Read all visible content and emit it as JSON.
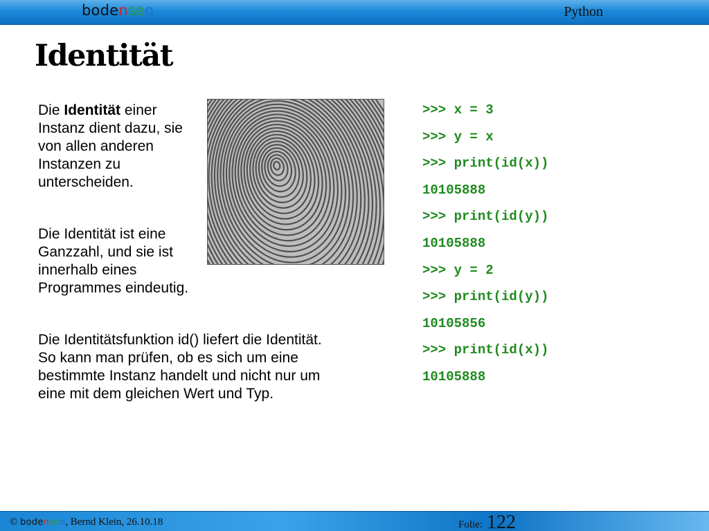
{
  "header": {
    "logo": {
      "part1": "bode",
      "part2": "n",
      "part3": "se",
      "part4": "o"
    },
    "title": "Python"
  },
  "slide": {
    "title": "Identität",
    "paragraph1": {
      "before": "Die ",
      "bold": "Identität",
      "after": " einer Instanz dient dazu, sie von allen anderen Instanzen zu unterscheiden."
    },
    "paragraph2": "Die Identität ist eine Ganzzahl, und sie ist innerhalb eines Programmes eindeutig.",
    "paragraph3": "Die Identitätsfunktion id() liefert die Identität. So kann man prüfen, ob es sich um eine bestimmte Instanz handelt und nicht nur um eine mit dem gleichen Wert und Typ.",
    "image": {
      "icon": "fingerprint-image"
    },
    "code_color": "#1e8a1e",
    "code_lines": [
      ">>> x = 3",
      ">>> y = x",
      ">>> print(id(x))",
      "10105888",
      ">>> print(id(y))",
      "10105888",
      ">>> y = 2",
      ">>> print(id(y))",
      "10105856",
      ">>> print(id(x))",
      "10105888"
    ]
  },
  "footer": {
    "copyright": "© ",
    "logo": {
      "part1": "bode",
      "part2": "n",
      "part3": "se",
      "part4": "o"
    },
    "author": ", Bernd Klein, 26.10.18",
    "slide_label": "Folie:",
    "slide_number": "122"
  }
}
